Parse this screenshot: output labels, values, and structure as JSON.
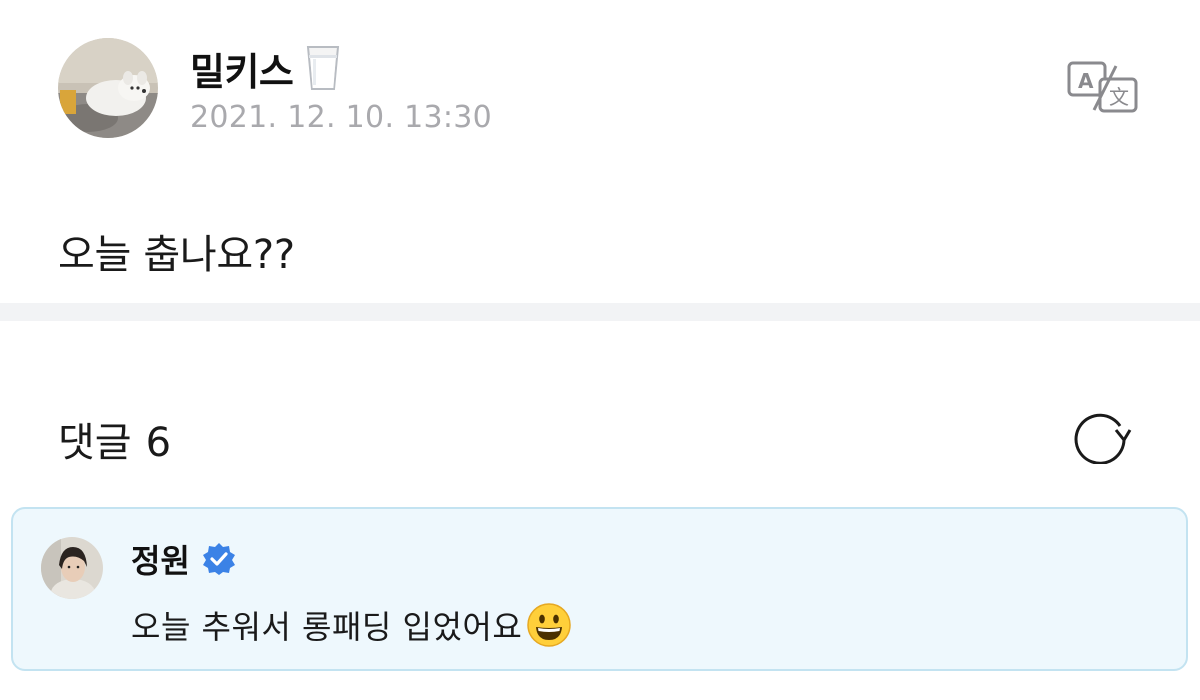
{
  "post": {
    "author": "밀키스",
    "author_emoji_icon": "milk-glass-icon",
    "date": "2021. 12. 10. 13:30",
    "body": "오늘 춥나요??",
    "translate_icon": "translate-icon"
  },
  "comments": {
    "label": "댓글",
    "count": "6",
    "refresh_icon": "refresh-icon"
  },
  "highlighted_comment": {
    "author": "정원",
    "verified_icon": "verified-badge-icon",
    "text": "오늘 추워서 롱패딩 입었어요",
    "emoji_icon": "grinning-face-icon"
  },
  "colors": {
    "date_gray": "#a9a9ad",
    "divider": "#f2f3f5",
    "comment_bg": "#eef8fd",
    "comment_border": "#c3e3f1",
    "verified_blue": "#3b82e6"
  }
}
